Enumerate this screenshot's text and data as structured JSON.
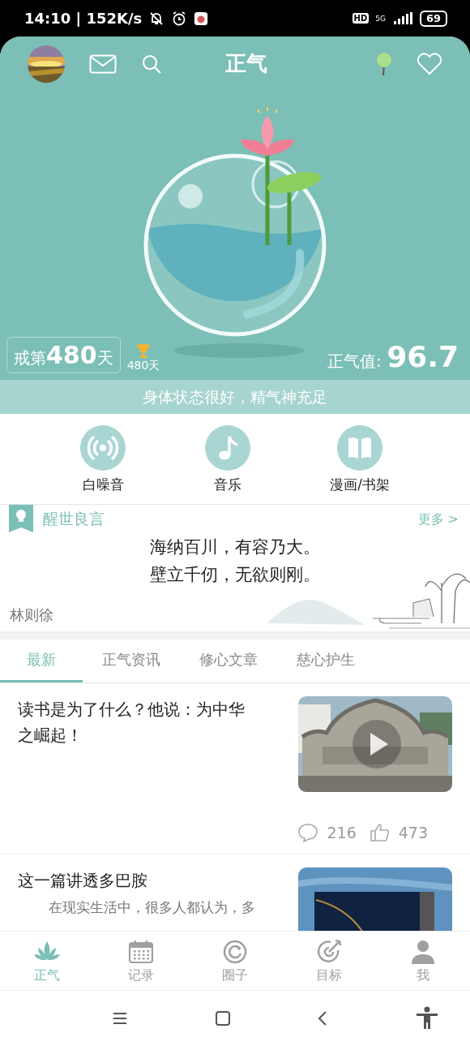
{
  "status_bar": {
    "time": "14:10 | 152K/s",
    "hd": "HD",
    "network": "5G",
    "battery": "69"
  },
  "header": {
    "title": "正气"
  },
  "hero": {
    "streak_prefix": "戒第",
    "streak_days": "480",
    "streak_suffix": "天",
    "trophy_label": "480天",
    "score_label": "正气值:",
    "score": "96.7",
    "status_text": "身体状态很好，精气神充足"
  },
  "shortcuts": [
    {
      "label": "白噪音",
      "kind": "radio"
    },
    {
      "label": "音乐",
      "kind": "music"
    },
    {
      "label": "漫画/书架",
      "kind": "book"
    }
  ],
  "quote": {
    "title": "醒世良言",
    "more": "更多 >",
    "lines": [
      "海纳百川，有容乃大。",
      "壁立千仞，无欲则刚。"
    ],
    "author": "林则徐"
  },
  "tabs": [
    {
      "label": "最新",
      "selected": true
    },
    {
      "label": "正气资讯",
      "selected": false
    },
    {
      "label": "修心文章",
      "selected": false
    },
    {
      "label": "慈心护生",
      "selected": false
    }
  ],
  "articles": [
    {
      "title": "读书是为了什么？他说：为中华之崛起！",
      "kind": "video",
      "comments": "216",
      "likes": "473"
    },
    {
      "title": "这一篇讲透多巴胺",
      "kind": "picture",
      "summary": "在现实生活中，很多人都认为，多"
    }
  ],
  "bottom_nav": [
    {
      "label": "正气",
      "kind": "lotus",
      "selected": true
    },
    {
      "label": "记录",
      "kind": "calendar",
      "selected": false
    },
    {
      "label": "圈子",
      "kind": "circle",
      "selected": false
    },
    {
      "label": "目标",
      "kind": "target",
      "selected": false
    },
    {
      "label": "我",
      "kind": "person",
      "selected": false
    }
  ]
}
